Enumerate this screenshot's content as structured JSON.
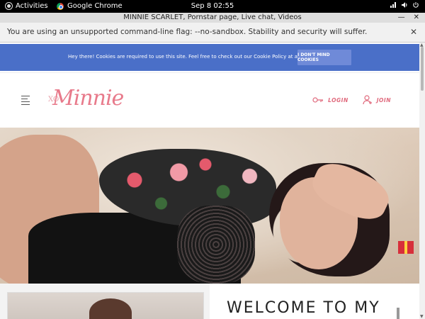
{
  "system": {
    "activities_label": "Activities",
    "app_label": "Google Chrome",
    "clock": "Sep 8  02:55",
    "tray_icons": [
      "network-icon",
      "volume-icon",
      "power-icon"
    ]
  },
  "browser": {
    "window_title": "MINNIE SCARLET, Pornstar page, Live chat, Videos",
    "infobar_message": "You are using an unsupported command-line flag: --no-sandbox. Stability and security will suffer.",
    "controls": [
      "minimize-icon",
      "close-icon"
    ]
  },
  "cookie_banner": {
    "text": "Hey there! Cookies are required to use this site. Feel free to check out our Cookie Policy at any time.",
    "button_label": "I DON'T MIND COOKIES"
  },
  "site": {
    "logo_prefix": "XO",
    "logo_name": "Minnie",
    "nav": {
      "login_label": "LOGIN",
      "join_label": "JOIN"
    },
    "welcome_heading": "WELCOME TO MY"
  },
  "colors": {
    "brand_pink": "#e06a7d",
    "cookie_bar": "#4a6fc8"
  }
}
